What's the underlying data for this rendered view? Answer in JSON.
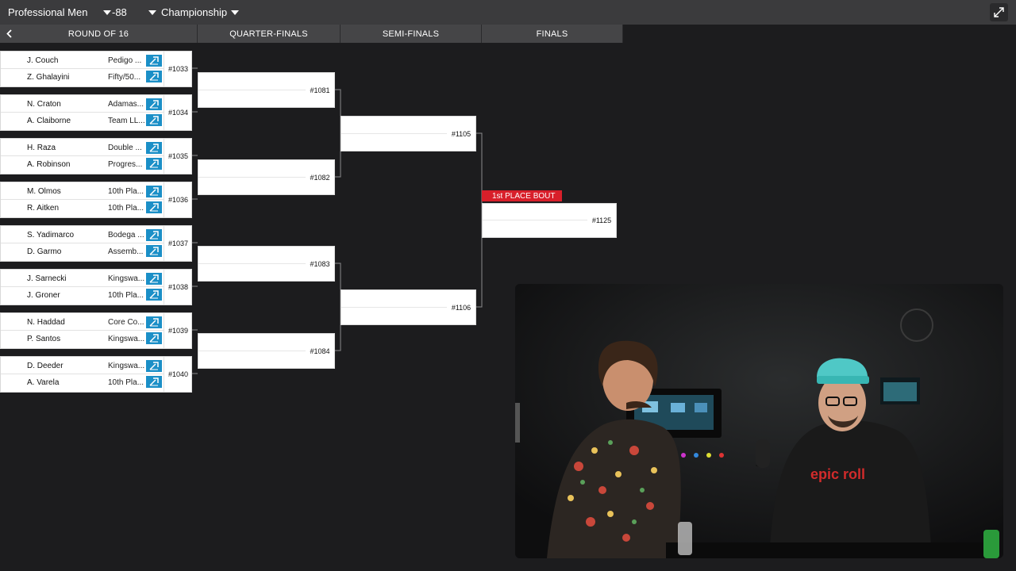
{
  "filters": {
    "division": "Professional Men",
    "weight": "-88",
    "bracket": "Championship"
  },
  "icons": {
    "back": "chevron-left-icon",
    "expand": "expand-arrows-icon",
    "win": "submission-arrow-icon",
    "caret": "caret-down-icon"
  },
  "colors": {
    "accent_blue": "#1b8fc7",
    "badge_red": "#d81f2a",
    "topbar": "#3b3b3d",
    "background": "#1c1c1e"
  },
  "rounds": [
    "ROUND OF 16",
    "QUARTER-FINALS",
    "SEMI-FINALS",
    "FINALS"
  ],
  "round_of_16": [
    {
      "bout": "#1033",
      "top": {
        "name": "J. Couch",
        "team": "Pedigo ..."
      },
      "bottom": {
        "name": "Z. Ghalayini",
        "team": "Fifty/50..."
      }
    },
    {
      "bout": "#1034",
      "top": {
        "name": "N. Craton",
        "team": "Adamas..."
      },
      "bottom": {
        "name": "A. Claiborne",
        "team": "Team LL..."
      }
    },
    {
      "bout": "#1035",
      "top": {
        "name": "H. Raza",
        "team": "Double ..."
      },
      "bottom": {
        "name": "A. Robinson",
        "team": "Progres..."
      }
    },
    {
      "bout": "#1036",
      "top": {
        "name": "M. Olmos",
        "team": "10th Pla..."
      },
      "bottom": {
        "name": "R. Aitken",
        "team": "10th Pla..."
      }
    },
    {
      "bout": "#1037",
      "top": {
        "name": "S. Yadimarco",
        "team": "Bodega ..."
      },
      "bottom": {
        "name": "D. Garmo",
        "team": "Assemb..."
      }
    },
    {
      "bout": "#1038",
      "top": {
        "name": "J. Sarnecki",
        "team": "Kingswa..."
      },
      "bottom": {
        "name": "J. Groner",
        "team": "10th Pla..."
      }
    },
    {
      "bout": "#1039",
      "top": {
        "name": "N. Haddad",
        "team": "Core Co..."
      },
      "bottom": {
        "name": "P. Santos",
        "team": "Kingswa..."
      }
    },
    {
      "bout": "#1040",
      "top": {
        "name": "D. Deeder",
        "team": "Kingswa..."
      },
      "bottom": {
        "name": "A. Varela",
        "team": "10th Pla..."
      }
    }
  ],
  "quarter_finals": [
    {
      "bout": "#1081"
    },
    {
      "bout": "#1082"
    },
    {
      "bout": "#1083"
    },
    {
      "bout": "#1084"
    }
  ],
  "semi_finals": [
    {
      "bout": "#1105"
    },
    {
      "bout": "#1106"
    }
  ],
  "finals": {
    "badge": "1st PLACE BOUT",
    "bout": "#1125"
  },
  "webcam": {
    "shirt_text": "epic roll"
  }
}
